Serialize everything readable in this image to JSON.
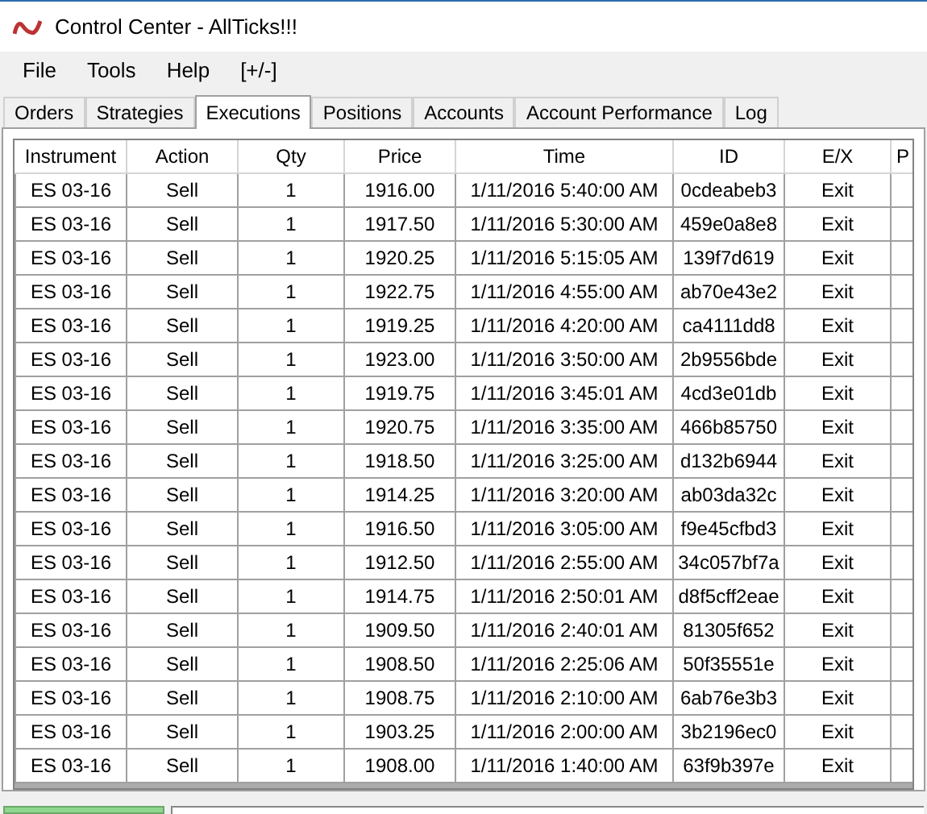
{
  "window": {
    "title": "Control Center - AllTicks!!!"
  },
  "menu": [
    "File",
    "Tools",
    "Help",
    "[+/-]"
  ],
  "tabs": [
    {
      "label": "Orders",
      "selected": false
    },
    {
      "label": "Strategies",
      "selected": false
    },
    {
      "label": "Executions",
      "selected": true
    },
    {
      "label": "Positions",
      "selected": false
    },
    {
      "label": "Accounts",
      "selected": false
    },
    {
      "label": "Account Performance",
      "selected": false
    },
    {
      "label": "Log",
      "selected": false
    }
  ],
  "table": {
    "columns": [
      "Instrument",
      "Action",
      "Qty",
      "Price",
      "Time",
      "ID",
      "E/X",
      "P"
    ],
    "rows": [
      [
        "ES 03-16",
        "Sell",
        "1",
        "1916.00",
        "1/11/2016 5:40:00 AM",
        "0cdeabeb3",
        "Exit"
      ],
      [
        "ES 03-16",
        "Sell",
        "1",
        "1917.50",
        "1/11/2016 5:30:00 AM",
        "459e0a8e8",
        "Exit"
      ],
      [
        "ES 03-16",
        "Sell",
        "1",
        "1920.25",
        "1/11/2016 5:15:05 AM",
        "139f7d619",
        "Exit"
      ],
      [
        "ES 03-16",
        "Sell",
        "1",
        "1922.75",
        "1/11/2016 4:55:00 AM",
        "ab70e43e2",
        "Exit"
      ],
      [
        "ES 03-16",
        "Sell",
        "1",
        "1919.25",
        "1/11/2016 4:20:00 AM",
        "ca4111dd8",
        "Exit"
      ],
      [
        "ES 03-16",
        "Sell",
        "1",
        "1923.00",
        "1/11/2016 3:50:00 AM",
        "2b9556bde",
        "Exit"
      ],
      [
        "ES 03-16",
        "Sell",
        "1",
        "1919.75",
        "1/11/2016 3:45:01 AM",
        "4cd3e01db",
        "Exit"
      ],
      [
        "ES 03-16",
        "Sell",
        "1",
        "1920.75",
        "1/11/2016 3:35:00 AM",
        "466b85750",
        "Exit"
      ],
      [
        "ES 03-16",
        "Sell",
        "1",
        "1918.50",
        "1/11/2016 3:25:00 AM",
        "d132b6944",
        "Exit"
      ],
      [
        "ES 03-16",
        "Sell",
        "1",
        "1914.25",
        "1/11/2016 3:20:00 AM",
        "ab03da32c",
        "Exit"
      ],
      [
        "ES 03-16",
        "Sell",
        "1",
        "1916.50",
        "1/11/2016 3:05:00 AM",
        "f9e45cfbd3",
        "Exit"
      ],
      [
        "ES 03-16",
        "Sell",
        "1",
        "1912.50",
        "1/11/2016 2:55:00 AM",
        "34c057bf7a",
        "Exit"
      ],
      [
        "ES 03-16",
        "Sell",
        "1",
        "1914.75",
        "1/11/2016 2:50:01 AM",
        "d8f5cff2eae",
        "Exit"
      ],
      [
        "ES 03-16",
        "Sell",
        "1",
        "1909.50",
        "1/11/2016 2:40:01 AM",
        "81305f652",
        "Exit"
      ],
      [
        "ES 03-16",
        "Sell",
        "1",
        "1908.50",
        "1/11/2016 2:25:06 AM",
        "50f35551e",
        "Exit"
      ],
      [
        "ES 03-16",
        "Sell",
        "1",
        "1908.75",
        "1/11/2016 2:10:00 AM",
        "6ab76e3b3",
        "Exit"
      ],
      [
        "ES 03-16",
        "Sell",
        "1",
        "1903.25",
        "1/11/2016 2:00:00 AM",
        "3b2196ec0",
        "Exit"
      ],
      [
        "ES 03-16",
        "Sell",
        "1",
        "1908.00",
        "1/11/2016 1:40:00 AM",
        "63f9b397e",
        "Exit"
      ]
    ]
  }
}
